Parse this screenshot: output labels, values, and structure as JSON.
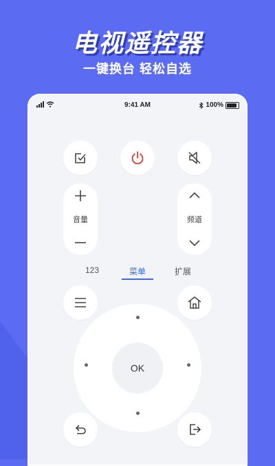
{
  "hero": {
    "title": "电视遥控器",
    "subtitle": "一键换台 轻松自选"
  },
  "status_bar": {
    "time": "9:41 AM",
    "battery": "100%"
  },
  "remote": {
    "volume_label": "音量",
    "channel_label": "频道",
    "tabs": [
      {
        "label": "123",
        "active": false
      },
      {
        "label": "菜单",
        "active": true
      },
      {
        "label": "扩展",
        "active": false
      }
    ],
    "ok_label": "OK"
  },
  "colors": {
    "background": "#5b6cf3",
    "accent": "#3f6bd8",
    "power": "#e53935"
  }
}
